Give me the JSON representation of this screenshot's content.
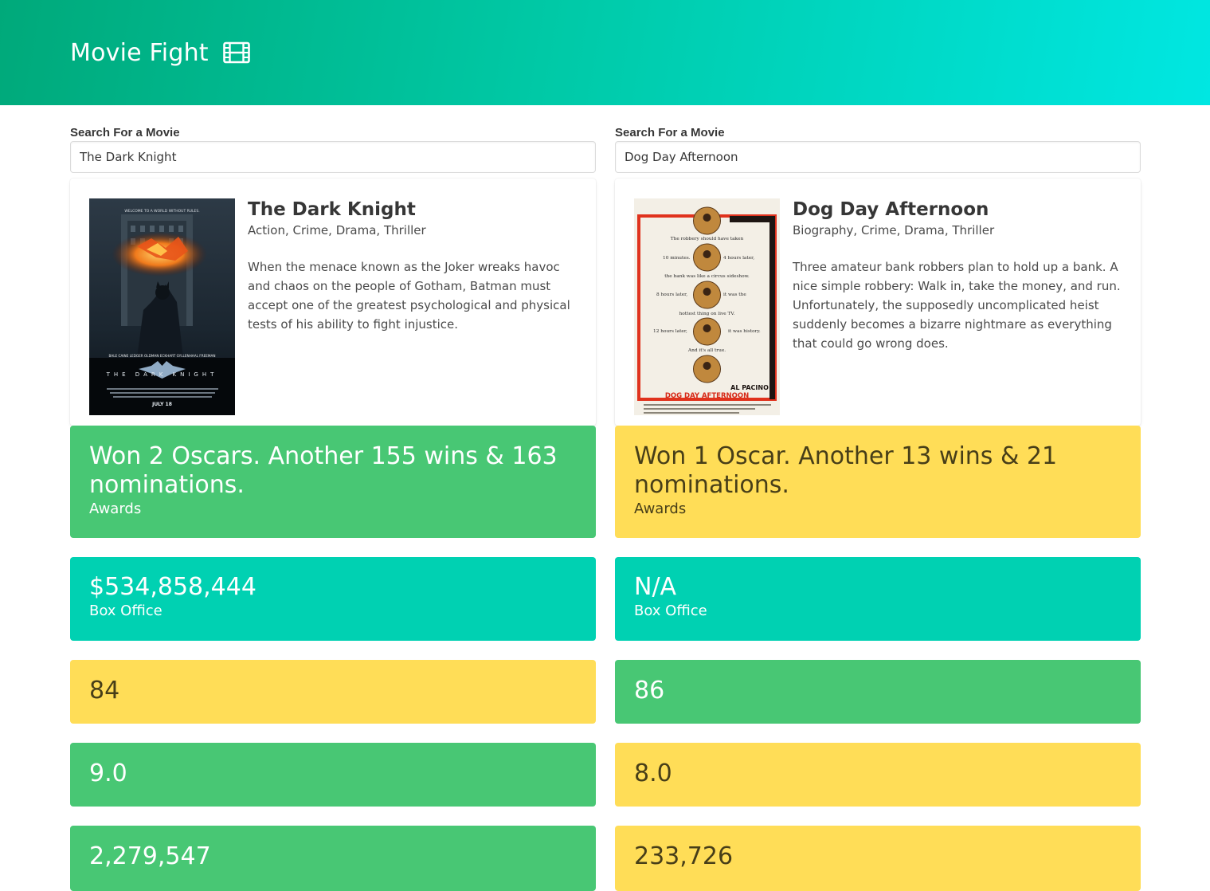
{
  "header": {
    "title": "Movie Fight",
    "icon": "film-icon"
  },
  "left": {
    "search_label": "Search For a Movie",
    "search_value": "The Dark Knight",
    "movie": {
      "title": "The Dark Knight",
      "genre": "Action, Crime, Drama, Thriller",
      "plot": "When the menace known as the Joker wreaks havoc and chaos on the people of Gotham, Batman must accept one of the greatest psychological and physical tests of his ability to fight injustice."
    },
    "poster": {
      "tagline": "WELCOME TO A WORLD WITHOUT RULES.",
      "cast": "BALE CAINE LEDGER OLDMAN ECKHART GYLLENHAAL FREEMAN",
      "title": "THE DARK KNIGHT",
      "date": "JULY 18"
    },
    "awards": {
      "value": "Won 2 Oscars. Another 155 wins & 163 nominations.",
      "label": "Awards",
      "color": "#48c774"
    },
    "box_office": {
      "value": "$534,858,444",
      "label": "Box Office",
      "color": "#00d1b2"
    },
    "metascore": {
      "value": "84",
      "color": "#ffdd57"
    },
    "imdb_rating": {
      "value": "9.0",
      "color": "#48c774"
    },
    "imdb_votes": {
      "value": "2,279,547",
      "color": "#48c774"
    }
  },
  "right": {
    "search_label": "Search For a Movie",
    "search_value": "Dog Day Afternoon",
    "movie": {
      "title": "Dog Day Afternoon",
      "genre": "Biography, Crime, Drama, Thriller",
      "plot": "Three amateur bank robbers plan to hold up a bank. A nice simple robbery: Walk in, take the money, and run. Unfortunately, the supposedly uncomplicated heist suddenly becomes a bizarre nightmare as everything that could go wrong does."
    },
    "poster": {
      "lines": [
        "The robbery should have taken",
        "10 minutes.",
        "4 hours later,",
        "the bank was like a circus sideshow.",
        "8 hours later,",
        "it was the",
        "hottest thing on live TV.",
        "12 hours later,",
        "it was history.",
        "And it's all true."
      ],
      "star": "AL PACINO",
      "title": "DOG DAY AFTERNOON"
    },
    "awards": {
      "value": "Won 1 Oscar. Another 13 wins & 21 nominations.",
      "label": "Awards",
      "color": "#ffdd57"
    },
    "box_office": {
      "value": "N/A",
      "label": "Box Office",
      "color": "#00d1b2"
    },
    "metascore": {
      "value": "86",
      "color": "#48c774"
    },
    "imdb_rating": {
      "value": "8.0",
      "color": "#ffdd57"
    },
    "imdb_votes": {
      "value": "233,726",
      "color": "#ffdd57"
    }
  }
}
